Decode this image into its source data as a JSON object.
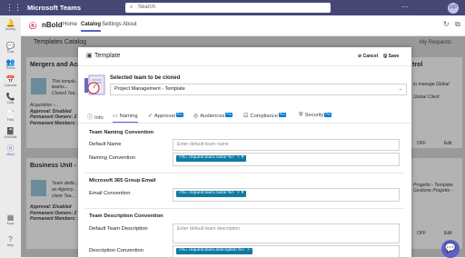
{
  "app": {
    "title": "Microsoft Teams",
    "search_placeholder": "Search",
    "top_more": "···",
    "user_initials": "PP"
  },
  "rail": [
    {
      "label": "Activity",
      "glyph": "🔔"
    },
    {
      "label": "Chat",
      "glyph": "💬"
    },
    {
      "label": "Teams",
      "glyph": "👥"
    },
    {
      "label": "Calendar",
      "glyph": "📅"
    },
    {
      "label": "Calls",
      "glyph": "📞"
    },
    {
      "label": "Files",
      "glyph": "📄"
    },
    {
      "label": "OneNote",
      "glyph": "📓"
    },
    {
      "label": "nBold",
      "glyph": "ⓝ"
    },
    {
      "label": "Apps",
      "glyph": "▦"
    },
    {
      "label": "Help",
      "glyph": "?"
    }
  ],
  "header": {
    "logo": "ⓝ",
    "brand": "nBold",
    "tabs": [
      "Home",
      "Catalog",
      "Settings",
      "About"
    ],
    "reload_glyph": "↻",
    "popout_glyph": "⧉"
  },
  "background": {
    "title": "Templates Catalog",
    "my_requests": "My Requests",
    "card1": {
      "title": "Mergers and Acqu...",
      "lines": [
        "This temple...",
        "teams...",
        "Cloned Tea...",
        "Acquisition -...",
        "Approval: Disabled",
        "Permanent Owners: 2",
        "Permanent Members: 1"
      ]
    },
    "card2": {
      "title": "Business Unit - C...",
      "lines": [
        "Team dedic...",
        "an Agency...",
        "clone Tea...",
        "Approval: Disabled",
        "Permanent Owners: 2",
        "Permanent Members: 1"
      ]
    },
    "card3": {
      "title": "trol",
      "lines": [
        "to manage Global",
        "Global Client"
      ]
    },
    "card4": {
      "lines": [
        "Progetto - Template",
        "Gestione Progetto -"
      ]
    },
    "off_label": "OFF",
    "edit_label": "Edit"
  },
  "modal": {
    "title": "Template",
    "cancel": "Cancel",
    "save": "Save",
    "selected_label": "Selected team to be cloned",
    "selected_value": "Project Management - Template",
    "tabs": [
      {
        "label": "Info",
        "glyph": "ⓘ",
        "pro": ""
      },
      {
        "label": "Naming",
        "glyph": "▭",
        "pro": ""
      },
      {
        "label": "Approval",
        "glyph": "✓",
        "pro": "Pro"
      },
      {
        "label": "Audiences",
        "glyph": "◎",
        "pro": "Pro"
      },
      {
        "label": "Compliance",
        "glyph": "☑",
        "pro": "Pro"
      },
      {
        "label": "Security",
        "glyph": "⛨",
        "pro": "Pro"
      }
    ],
    "sections": {
      "team_naming": "Team Naming Convention",
      "default_name_label": "Default Name",
      "default_name_placeholder": "Enter default team name",
      "naming_convention_label": "Naming Convention",
      "naming_chip": "<%= request.team.name %>",
      "m365_group": "Microsoft 365 Group Email",
      "email_convention_label": "Email Convention",
      "email_chip": "<%= request.team.name %>",
      "team_desc": "Team Description Convention",
      "default_desc_label": "Default Team Description",
      "default_desc_placeholder": "Enter default team description",
      "desc_convention_label": "Description Convention",
      "desc_chip": "<%= request.team.description %>"
    }
  },
  "colors": {
    "teams_purple": "#464775",
    "accent": "#5b5fc7",
    "chip": "#0e7ba3",
    "pro_badge": "#0078d4",
    "brand_red": "#c8102e"
  }
}
